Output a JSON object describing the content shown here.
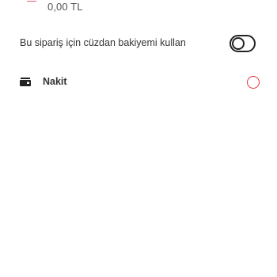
{
  "wallet": {
    "balance": "0,00 TL",
    "usage_label": "Bu sipariş için cüzdan bakiyemi kullan",
    "toggle_enabled": false
  },
  "payment_methods": [
    {
      "label": "Nakit",
      "icon": "cash-icon",
      "selected": false
    }
  ],
  "colors": {
    "accent": "#e4333f",
    "text": "#333333",
    "secondary_text": "#555555"
  }
}
